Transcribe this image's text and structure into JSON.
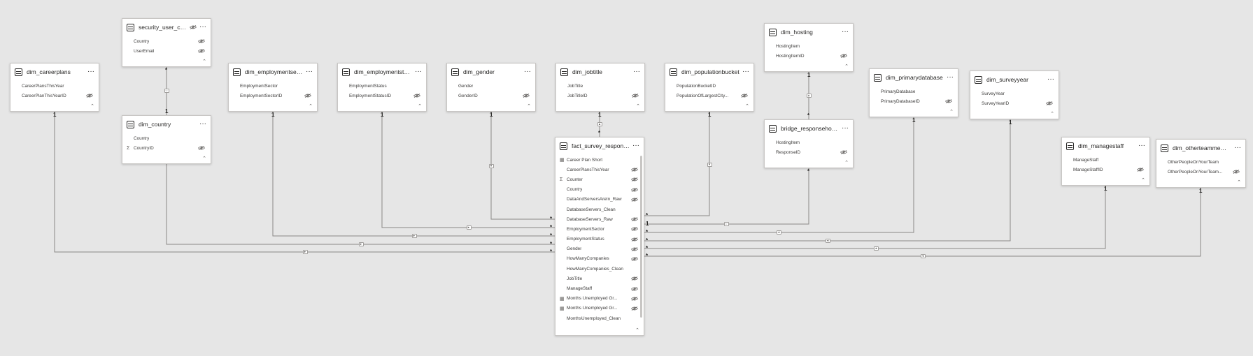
{
  "tables": [
    {
      "title": "dim_careerplans",
      "fields": [
        {
          "name": "CareerPlansThisYear"
        },
        {
          "name": "CareerPlanThisYearID",
          "hidden": true
        }
      ]
    },
    {
      "title": "security_user_count...",
      "fields": [
        {
          "name": "Country",
          "hidden": true
        },
        {
          "name": "UserEmail",
          "hidden": true
        }
      ]
    },
    {
      "title": "dim_country",
      "fields": [
        {
          "name": "Country"
        },
        {
          "name": "CountryID",
          "hidden": true,
          "icon": "Σ"
        }
      ]
    },
    {
      "title": "dim_employmentsector",
      "fields": [
        {
          "name": "EmploymentSector"
        },
        {
          "name": "EmploymentSectorID",
          "hidden": true
        }
      ]
    },
    {
      "title": "dim_employmentstatus",
      "fields": [
        {
          "name": "EmploymentStatus"
        },
        {
          "name": "EmploymentStatusID",
          "hidden": true
        }
      ]
    },
    {
      "title": "dim_gender",
      "fields": [
        {
          "name": "Gender"
        },
        {
          "name": "GenderID",
          "hidden": true
        }
      ]
    },
    {
      "title": "dim_jobtitle",
      "fields": [
        {
          "name": "JobTitle"
        },
        {
          "name": "JobTitleID",
          "hidden": true
        }
      ]
    },
    {
      "title": "dim_populationbucket",
      "fields": [
        {
          "name": "PopulationBucketID"
        },
        {
          "name": "PopulationOfLargestCity...",
          "hidden": true
        }
      ]
    },
    {
      "title": "dim_hosting",
      "fields": [
        {
          "name": "HostingItem"
        },
        {
          "name": "HostingItemID",
          "hidden": true
        }
      ]
    },
    {
      "title": "bridge_responsehosting",
      "fields": [
        {
          "name": "HostingItem"
        },
        {
          "name": "ResponseID",
          "hidden": true
        }
      ]
    },
    {
      "title": "dim_primarydatabase",
      "fields": [
        {
          "name": "PrimaryDatabase"
        },
        {
          "name": "PrimaryDatabaseID",
          "hidden": true
        }
      ]
    },
    {
      "title": "dim_surveyyear",
      "fields": [
        {
          "name": "SurveyYear"
        },
        {
          "name": "SurveyYearID",
          "hidden": true
        }
      ]
    },
    {
      "title": "dim_managestaff",
      "fields": [
        {
          "name": "ManageStaff"
        },
        {
          "name": "ManageStaffID",
          "hidden": true
        }
      ]
    },
    {
      "title": "dim_otherteammembers",
      "fields": [
        {
          "name": "OtherPeopleOnYourTeam"
        },
        {
          "name": "OtherPeopleOnYourTeam...",
          "hidden": true
        }
      ]
    },
    {
      "title": "fact_survey_response",
      "fields": [
        {
          "name": "Career Plan Short",
          "icon": "▦"
        },
        {
          "name": "CareerPlansThisYear",
          "hidden": true
        },
        {
          "name": "Counter",
          "hidden": true,
          "icon": "Σ"
        },
        {
          "name": "Country",
          "hidden": true
        },
        {
          "name": "DataAndServersAreIn_Raw",
          "hidden": true
        },
        {
          "name": "DatabaseServers_Clean"
        },
        {
          "name": "DatabaseServers_Raw",
          "hidden": true
        },
        {
          "name": "EmploymentSector",
          "hidden": true
        },
        {
          "name": "EmploymentStatus",
          "hidden": true
        },
        {
          "name": "Gender",
          "hidden": true
        },
        {
          "name": "HowManyCompanies",
          "hidden": true
        },
        {
          "name": "HowManyCompanies_Clean"
        },
        {
          "name": "JobTitle",
          "hidden": true
        },
        {
          "name": "ManageStaff",
          "hidden": true
        },
        {
          "name": "Months Unemployed Gr...",
          "hidden": true,
          "icon": "▦"
        },
        {
          "name": "Months Unemployed Gr...",
          "hidden": true,
          "icon": "▦"
        },
        {
          "name": "MonthsUnemployed_Clean"
        }
      ]
    }
  ],
  "cardinality": {
    "one": "1",
    "many": "*"
  }
}
